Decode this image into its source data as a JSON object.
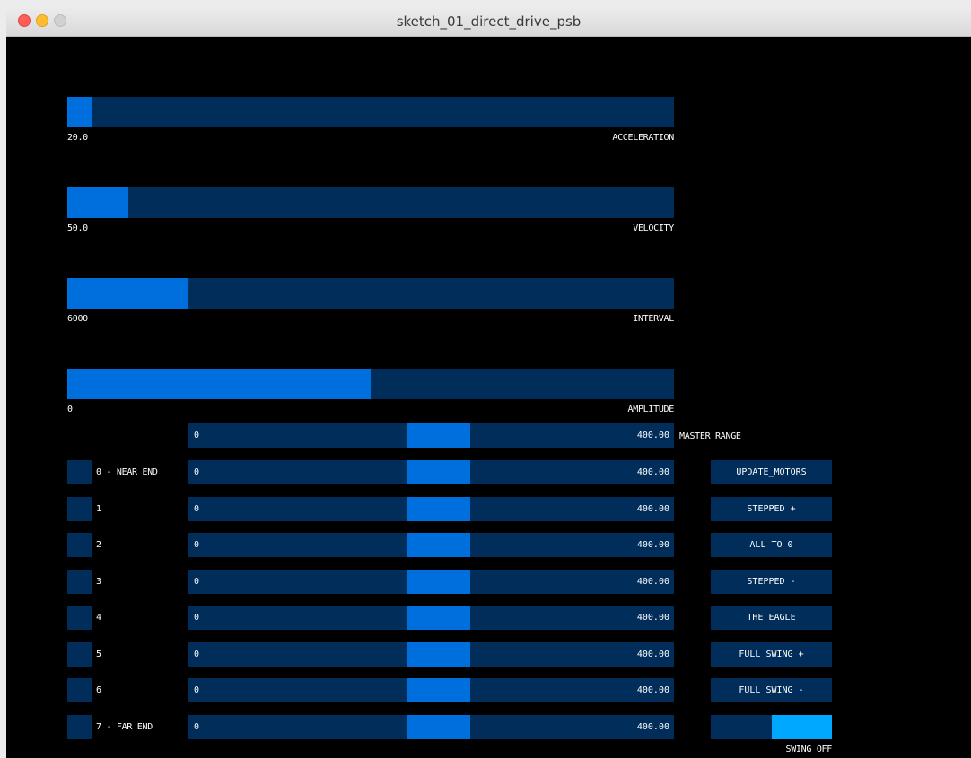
{
  "window": {
    "title": "sketch_01_direct_drive_psb"
  },
  "sliders": [
    {
      "name": "acceleration",
      "value_text": "20.0",
      "label": "ACCELERATION",
      "fraction": 0.04
    },
    {
      "name": "velocity",
      "value_text": "50.0",
      "label": "VELOCITY",
      "fraction": 0.1
    },
    {
      "name": "interval",
      "value_text": "6000",
      "label": "INTERVAL",
      "fraction": 0.2
    },
    {
      "name": "amplitude",
      "value_text": "0",
      "label": "AMPLITUDE",
      "fraction": 0.5
    }
  ],
  "master_range": {
    "min_text": "0",
    "max_text": "400.00",
    "label": "MASTER RANGE",
    "handle_start": 0.45,
    "handle_end": 0.58
  },
  "motors": [
    {
      "label": "0 - NEAR END",
      "min_text": "0",
      "max_text": "400.00"
    },
    {
      "label": "1",
      "min_text": "0",
      "max_text": "400.00"
    },
    {
      "label": "2",
      "min_text": "0",
      "max_text": "400.00"
    },
    {
      "label": "3",
      "min_text": "0",
      "max_text": "400.00"
    },
    {
      "label": "4",
      "min_text": "0",
      "max_text": "400.00"
    },
    {
      "label": "5",
      "min_text": "0",
      "max_text": "400.00"
    },
    {
      "label": "6",
      "min_text": "0",
      "max_text": "400.00"
    },
    {
      "label": "7 - FAR END",
      "min_text": "0",
      "max_text": "400.00"
    }
  ],
  "buttons": [
    {
      "label": "UPDATE_MOTORS"
    },
    {
      "label": "STEPPED +"
    },
    {
      "label": "ALL TO 0"
    },
    {
      "label": "STEPPED -"
    },
    {
      "label": "THE EAGLE"
    },
    {
      "label": "FULL SWING +"
    },
    {
      "label": "FULL SWING -"
    }
  ],
  "swing_toggle": {
    "label": "SWING OFF",
    "state": "off"
  },
  "colors": {
    "track": "#002d5a",
    "fill": "#006fde",
    "toggle_on": "#00a8ff"
  }
}
